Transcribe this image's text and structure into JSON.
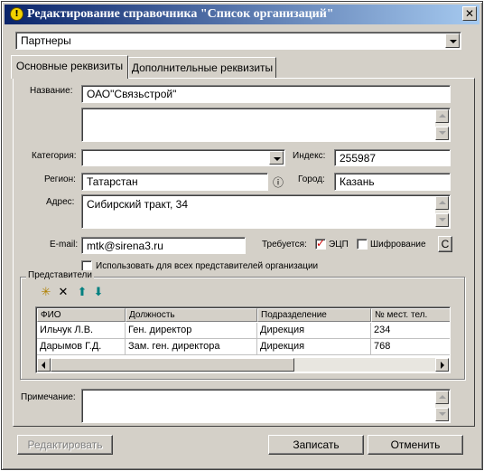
{
  "window": {
    "title": "Редактирование справочника \"Список организаций\"",
    "close": "✕",
    "info_icon": "info-icon"
  },
  "directory": {
    "selected": "Партнеры"
  },
  "tabs": [
    {
      "label": "Основные реквизиты",
      "active": true
    },
    {
      "label": "Дополнительные реквизиты",
      "active": false
    }
  ],
  "form": {
    "name_label": "Название:",
    "name_value": "ОАО\"Связьстрой\"",
    "name_extra": "",
    "category_label": "Категория:",
    "category_value": "",
    "index_label": "Индекс:",
    "index_value": "255987",
    "region_label": "Регион:",
    "region_value": "Татарстан",
    "city_label": "Город:",
    "city_value": "Казань",
    "address_label": "Адрес:",
    "address_value": "Сибирский тракт, 34",
    "email_label": "E-mail:",
    "email_value": "mtk@sirena3.ru",
    "requires_label": "Требуется:",
    "ecp_label": "ЭЦП",
    "ecp_checked": true,
    "encryption_label": "Шифрование",
    "encryption_checked": false,
    "c_button": "С",
    "use_all_label": "Использовать для всех представителей организации",
    "use_all_checked": false,
    "note_label": "Примечание:",
    "note_value": ""
  },
  "representatives": {
    "group_label": "Представители",
    "toolbar": [
      {
        "name": "add-icon",
        "glyph": "✳"
      },
      {
        "name": "delete-icon",
        "glyph": "✕"
      },
      {
        "name": "arrow-up-icon",
        "glyph": "⬆"
      },
      {
        "name": "arrow-down-icon",
        "glyph": "⬇"
      }
    ],
    "columns": [
      "ФИО",
      "Должность",
      "Подразделение",
      "№ мест. тел."
    ],
    "rows": [
      [
        "Ильчук Л.В.",
        "Ген. директор",
        "Дирекция",
        "234"
      ],
      [
        "Дарымов Г.Д.",
        "Зам. ген. директора",
        "Дирекция",
        "768"
      ]
    ]
  },
  "buttons": {
    "edit": "Редактировать",
    "save": "Записать",
    "cancel": "Отменить"
  }
}
